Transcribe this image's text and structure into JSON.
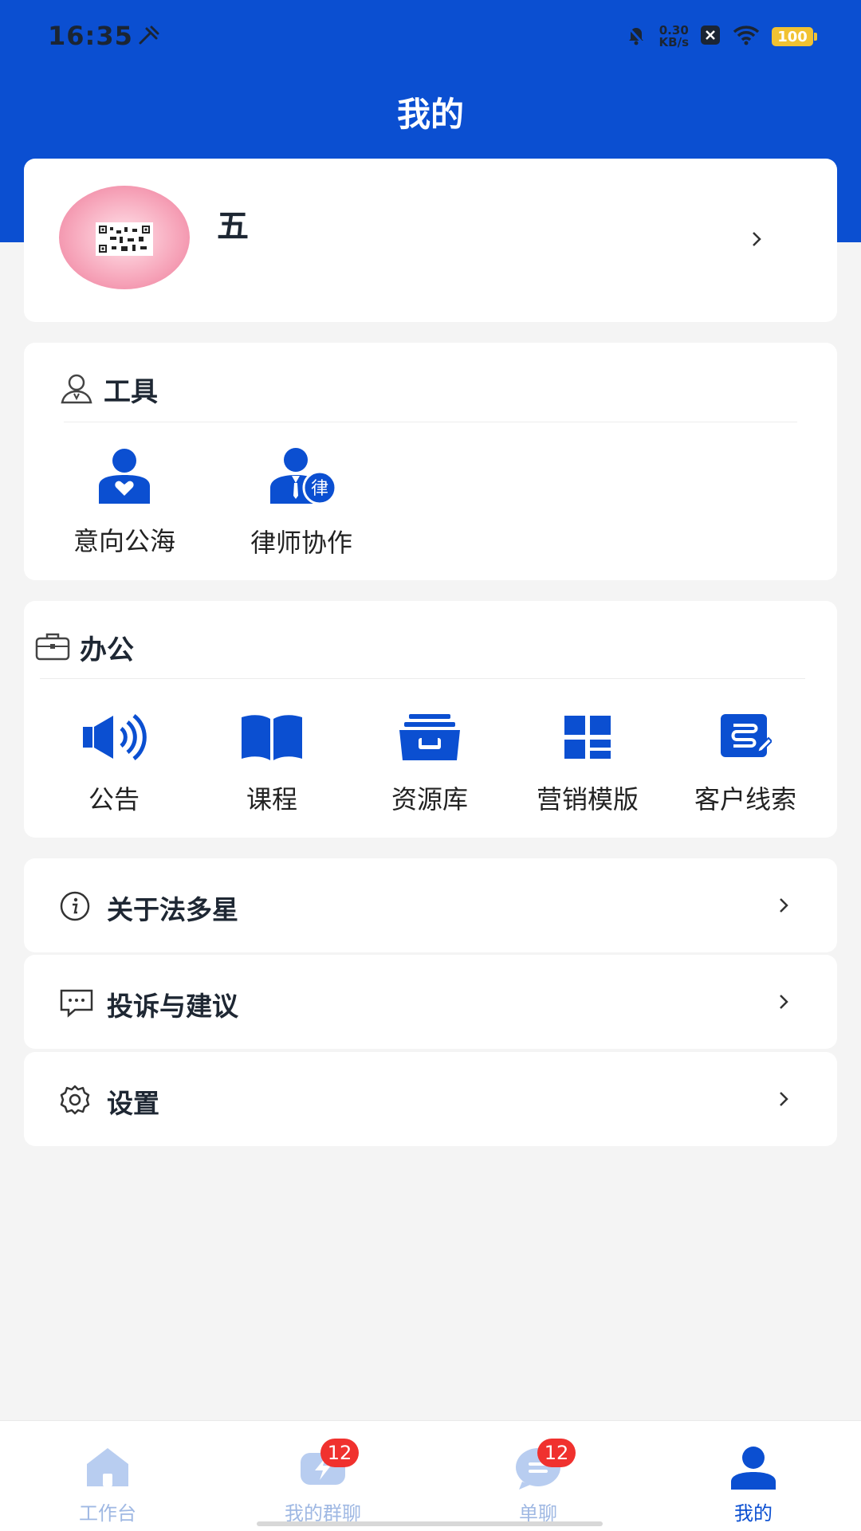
{
  "status_bar": {
    "time": "16:35",
    "net_speed_value": "0.30",
    "net_speed_unit": "KB/s",
    "battery": "100"
  },
  "header": {
    "title": "我的"
  },
  "profile": {
    "name": "五"
  },
  "tools": {
    "title": "工具",
    "items": [
      {
        "label": "意向公海",
        "icon": "user-heart-icon"
      },
      {
        "label": "律师协作",
        "icon": "lawyer-icon",
        "badge": "律"
      }
    ]
  },
  "office": {
    "title": "办公",
    "items": [
      {
        "label": "公告",
        "icon": "speaker-icon"
      },
      {
        "label": "课程",
        "icon": "book-icon"
      },
      {
        "label": "资源库",
        "icon": "archive-box-icon"
      },
      {
        "label": "营销模版",
        "icon": "template-grid-icon"
      },
      {
        "label": "客户线索",
        "icon": "client-lead-icon"
      }
    ]
  },
  "menu": [
    {
      "label": "关于法多星",
      "icon": "info-icon"
    },
    {
      "label": "投诉与建议",
      "icon": "feedback-icon"
    },
    {
      "label": "设置",
      "icon": "gear-icon"
    }
  ],
  "tabbar": {
    "tabs": [
      {
        "label": "工作台",
        "icon": "home-icon",
        "badge": ""
      },
      {
        "label": "我的群聊",
        "icon": "group-chat-icon",
        "badge": "12"
      },
      {
        "label": "单聊",
        "icon": "chat-icon",
        "badge": "12"
      },
      {
        "label": "我的",
        "icon": "person-icon",
        "badge": "",
        "active": true
      }
    ]
  },
  "colors": {
    "primary": "#0b4fd1",
    "badge": "#f0312e",
    "inactive_tab": "#9fb8e3",
    "background": "#f4f4f4"
  }
}
